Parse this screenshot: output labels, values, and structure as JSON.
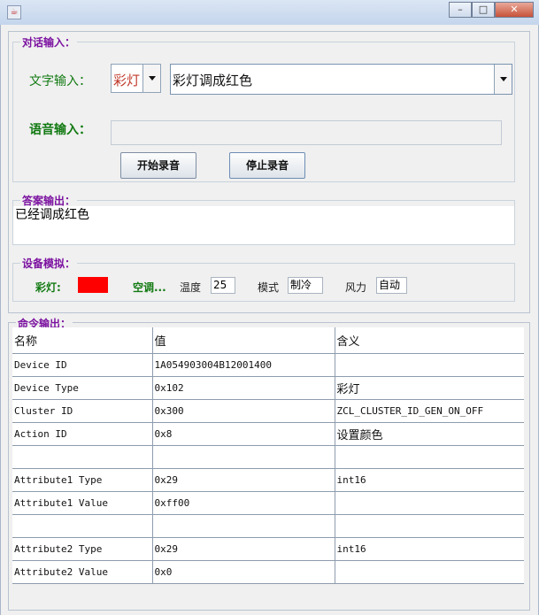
{
  "window": {
    "title": "",
    "app_icon": "java-icon",
    "controls": {
      "minimize": "–",
      "maximize": "□",
      "close": "✕"
    }
  },
  "dialog_input": {
    "title": "对话输入：",
    "text_label": "文字输入：",
    "device_combo_value": "彩灯",
    "command_combo_value": "彩灯调成红色",
    "voice_label": "语音输入：",
    "voice_value": "",
    "start_button": "开始录音",
    "stop_button": "停止录音"
  },
  "answer_output": {
    "title": "答案输出：",
    "text": "已经调成红色"
  },
  "device_sim": {
    "title": "设备模拟：",
    "light_label": "彩灯:",
    "light_color": "#ff0000",
    "ac_label": "空调...",
    "temp_label": "温度",
    "temp_value": "25",
    "mode_label": "模式",
    "mode_value": "制冷",
    "wind_label": "风力",
    "wind_value": "自动"
  },
  "command_output": {
    "title": "命令输出：",
    "columns": [
      "名称",
      "值",
      "含义"
    ],
    "rows": [
      [
        "Device ID",
        "1A054903004B12001400",
        ""
      ],
      [
        "Device Type",
        "0x102",
        "彩灯"
      ],
      [
        "Cluster ID",
        "0x300",
        "ZCL_CLUSTER_ID_GEN_ON_OFF"
      ],
      [
        "Action ID",
        "0x8",
        "设置颜色"
      ],
      [
        "",
        "",
        ""
      ],
      [
        "Attribute1 Type",
        "0x29",
        "int16"
      ],
      [
        "Attribute1 Value",
        "0xff00",
        ""
      ],
      [
        "",
        "",
        ""
      ],
      [
        "Attribute2 Type",
        "0x29",
        "int16"
      ],
      [
        "Attribute2 Value",
        "0x0",
        ""
      ]
    ]
  }
}
